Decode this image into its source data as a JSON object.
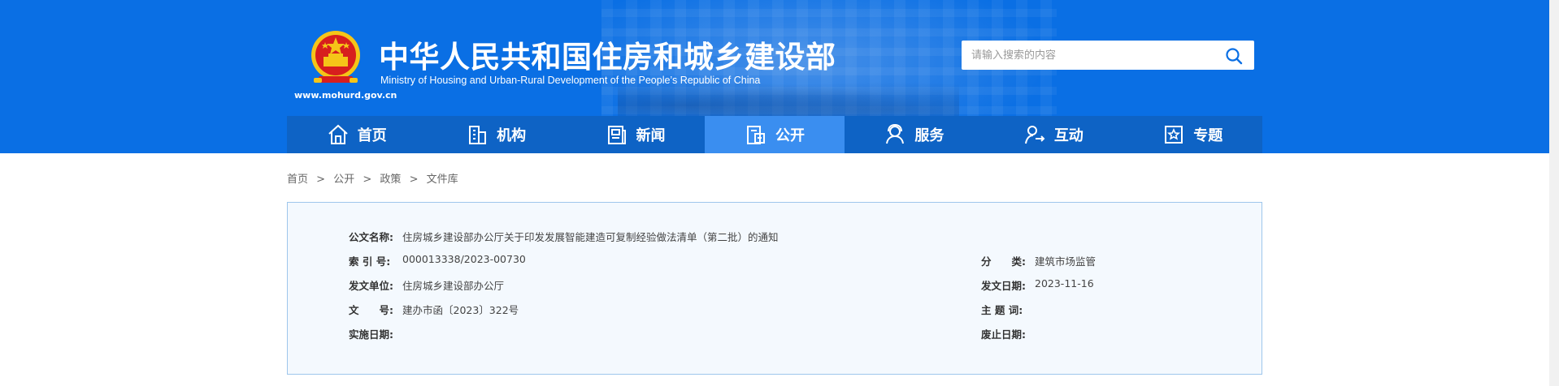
{
  "colors": {
    "header_bg": "#0a6fe4",
    "nav_bg": "#0e63c5",
    "nav_active": "#3a8ef0",
    "info_border": "#9ec6ec",
    "info_bg": "#f4f9fe"
  },
  "header": {
    "title_zh": "中华人民共和国住房和城乡建设部",
    "title_en": "Ministry of Housing and Urban-Rural Development of the People’s Republic of China",
    "site_url": "www.mohurd.gov.cn",
    "emblem_icon": "national-emblem-icon"
  },
  "search": {
    "placeholder": "请输入搜索的内容",
    "icon": "search-icon"
  },
  "nav": {
    "items": [
      {
        "label": "首页",
        "icon": "home-icon"
      },
      {
        "label": "机构",
        "icon": "building-icon"
      },
      {
        "label": "新闻",
        "icon": "news-icon"
      },
      {
        "label": "公开",
        "icon": "document-icon",
        "active": true
      },
      {
        "label": "服务",
        "icon": "service-icon"
      },
      {
        "label": "互动",
        "icon": "interaction-icon"
      },
      {
        "label": "专题",
        "icon": "topic-icon"
      }
    ]
  },
  "breadcrumb": {
    "items": [
      "首页",
      "公开",
      "政策",
      "文件库"
    ],
    "separator": ">"
  },
  "document_info": {
    "doc_name_label": "公文名称:",
    "doc_name_value": "住房城乡建设部办公厅关于印发发展智能建造可复制经验做法清单（第二批）的通知",
    "index_label": "索 引 号:",
    "index_value": "000013338/2023-00730",
    "category_label": "分　　类:",
    "category_value": "建筑市场监管",
    "issuer_label": "发文单位:",
    "issuer_value": "住房城乡建设部办公厅",
    "issue_date_label": "发文日期:",
    "issue_date_value": "2023-11-16",
    "doc_number_label": "文　　号:",
    "doc_number_value": "建办市函〔2023〕322号",
    "subject_label": "主 题 词:",
    "subject_value": "",
    "effective_date_label": "实施日期:",
    "effective_date_value": "",
    "repeal_date_label": "废止日期:",
    "repeal_date_value": ""
  }
}
